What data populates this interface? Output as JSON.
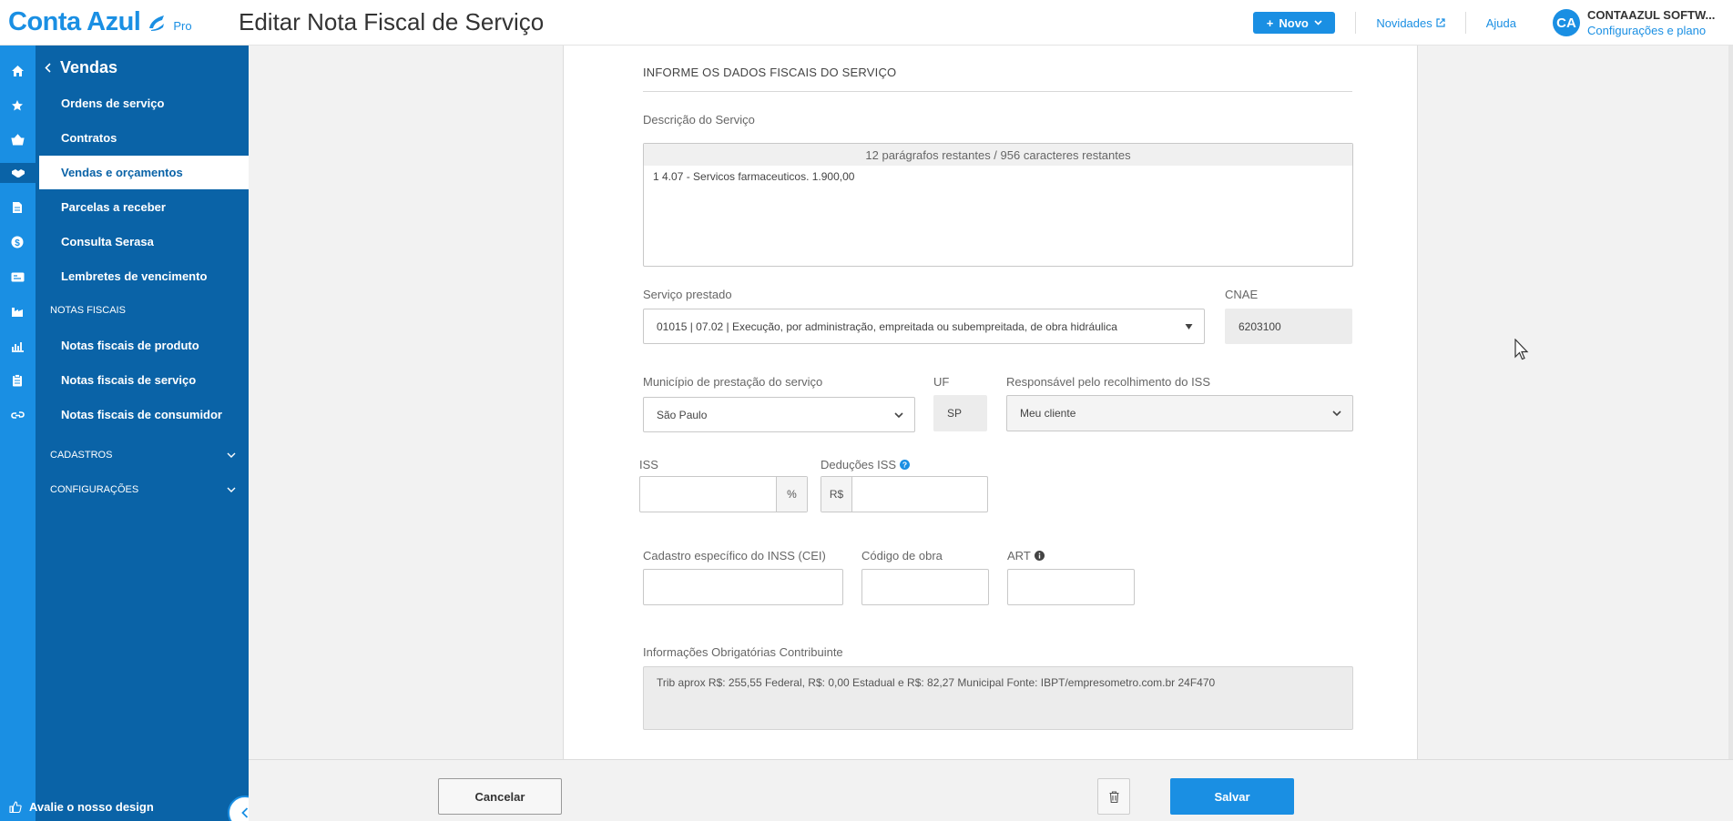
{
  "header": {
    "logo_text": "Conta Azul",
    "logo_badge": "Pro",
    "page_title": "Editar Nota Fiscal de Serviço",
    "new_button": "Novo",
    "news_link": "Novidades",
    "help_link": "Ajuda",
    "avatar_initials": "CA",
    "account_name": "CONTAAZUL SOFTW...",
    "account_plan": "Configurações e plano"
  },
  "rail_icons": [
    "home-icon",
    "star-icon",
    "basket-icon",
    "handshake-icon",
    "document-icon",
    "dollar-icon",
    "card-icon",
    "factory-icon",
    "chart-icon",
    "clipboard-icon",
    "link-icon"
  ],
  "sidebar": {
    "back_label": "Vendas",
    "items": [
      {
        "label": "Ordens de serviço"
      },
      {
        "label": "Contratos"
      },
      {
        "label": "Vendas e orçamentos"
      },
      {
        "label": "Parcelas a receber"
      },
      {
        "label": "Consulta Serasa"
      },
      {
        "label": "Lembretes de vencimento"
      }
    ],
    "section_notas": "NOTAS FISCAIS",
    "notas_items": [
      {
        "label": "Notas fiscais de produto"
      },
      {
        "label": "Notas fiscais de serviço"
      },
      {
        "label": "Notas fiscais de consumidor"
      }
    ],
    "cadastros": "CADASTROS",
    "configuracoes": "CONFIGURAÇÕES",
    "feedback": "Avalie o nosso design"
  },
  "form": {
    "section_title": "INFORME OS DADOS FISCAIS DO SERVIÇO",
    "descricao_label": "Descrição do Serviço",
    "descricao_counter": "12 parágrafos restantes / 956 caracteres restantes",
    "descricao_value": "1 4.07 - Servicos farmaceuticos. 1.900,00",
    "servico_label": "Serviço prestado",
    "servico_value": "01015 | 07.02 | Execução, por administração, empreitada ou subempreitada, de obra hidráulica",
    "cnae_label": "CNAE",
    "cnae_value": "6203100",
    "municipio_label": "Município de prestação do serviço",
    "municipio_value": "São Paulo",
    "uf_label": "UF",
    "uf_value": "SP",
    "responsavel_label": "Responsável pelo recolhimento do ISS",
    "responsavel_value": "Meu cliente",
    "iss_label": "ISS",
    "iss_value": "",
    "iss_unit": "%",
    "deducoes_label": "Deduções ISS",
    "deducoes_prefix": "R$",
    "deducoes_value": "",
    "cei_label": "Cadastro específico do INSS (CEI)",
    "cei_value": "",
    "obra_label": "Código de obra",
    "obra_value": "",
    "art_label": "ART",
    "art_value": "",
    "info_label": "Informações Obrigatórias Contribuinte",
    "info_value": "Trib aprox R$: 255,55 Federal, R$: 0,00 Estadual e R$: 82,27 Municipal Fonte: IBPT/empresometro.com.br   24F470"
  },
  "footer": {
    "cancel": "Cancelar",
    "save": "Salvar"
  },
  "colors": {
    "brand": "#1a8fe3",
    "sidebar": "#0a63a7"
  }
}
